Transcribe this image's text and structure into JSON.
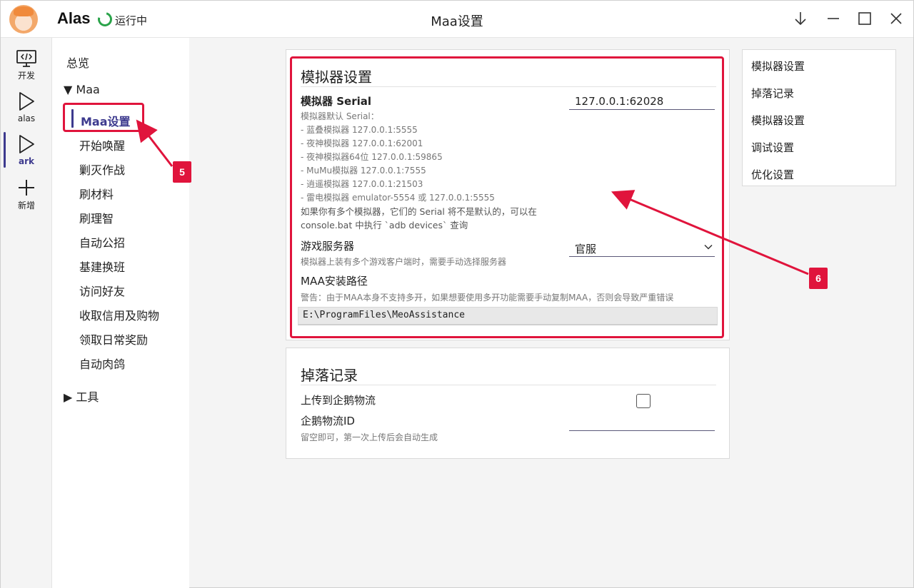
{
  "titlebar": {
    "app_name": "Alas",
    "status": "运行中",
    "window_title": "Maa设置"
  },
  "rail": {
    "items": [
      {
        "label": "开发",
        "icon": "code-monitor-icon"
      },
      {
        "label": "alas",
        "icon": "play-icon"
      },
      {
        "label": "ark",
        "icon": "play-icon"
      },
      {
        "label": "新增",
        "icon": "plus-icon"
      }
    ]
  },
  "nav": {
    "overview": "总览",
    "group_maa": "Maa",
    "items": [
      "Maa设置",
      "开始唤醒",
      "剿灭作战",
      "刷材料",
      "刷理智",
      "自动公招",
      "基建换班",
      "访问好友",
      "收取信用及购物",
      "领取日常奖励",
      "自动肉鸽"
    ],
    "group_tools": "工具"
  },
  "emulator_card": {
    "title": "模拟器设置",
    "serial_label": "模拟器 Serial",
    "serial_value": "127.0.0.1:62028",
    "serial_help": [
      "模拟器默认 Serial：",
      "- 蓝叠模拟器 127.0.0.1:5555",
      "- 夜神模拟器 127.0.0.1:62001",
      "- 夜神模拟器64位 127.0.0.1:59865",
      "- MuMu模拟器 127.0.0.1:7555",
      "- 逍遥模拟器 127.0.0.1:21503",
      "- 雷电模拟器 emulator-5554 或 127.0.0.1:5555"
    ],
    "serial_note_1": "如果你有多个模拟器，它们的 Serial 将不是默认的，可以在",
    "serial_note_2": "console.bat 中执行 `adb devices` 查询",
    "server_label": "游戏服务器",
    "server_help": "模拟器上装有多个游戏客户端时，需要手动选择服务器",
    "server_value": "官服",
    "path_label": "MAA安装路径",
    "path_help": "警告：由于MAA本身不支持多开，如果想要使用多开功能需要手动复制MAA，否则会导致严重错误",
    "path_value": "E:\\ProgramFiles\\MeoAssistance"
  },
  "drop_card": {
    "title": "掉落记录",
    "upload_label": "上传到企鹅物流",
    "upload_checked": false,
    "id_label": "企鹅物流ID",
    "id_help": "留空即可，第一次上传后会自动生成",
    "id_value": ""
  },
  "toc": {
    "items": [
      "模拟器设置",
      "掉落记录",
      "模拟器设置",
      "调试设置",
      "优化设置"
    ]
  },
  "annotations": {
    "badge_5": "5",
    "badge_6": "6",
    "color": "#e0143c"
  },
  "colors": {
    "accent": "#3d3a8e",
    "running": "#2aa34a"
  }
}
